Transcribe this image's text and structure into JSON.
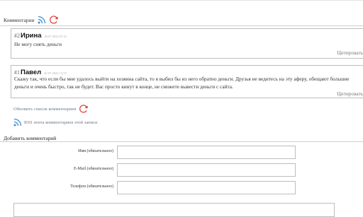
{
  "header": {
    "title": "Комментарии"
  },
  "comments": [
    {
      "num": "#2",
      "author": "Ирина",
      "date": "26.07.2022 07:31",
      "text": "Не могу снять деньги",
      "quote": "Цитировать"
    },
    {
      "num": "#1",
      "author": "Павел",
      "date": "26.07.2022 13:37",
      "text": "Скажу так, что если бы мне удалось выйти на хозяина сайта, то я выбил бы из него обратно деньги. Друзья не ведитесь на эту аферу, обещают большие деньги и очень быстро, так не будет. Вас просто кинут в конце, не сможете вывести деньги с сайта.",
      "quote": "Цитировать"
    }
  ],
  "refresh": {
    "label": "Обновить список комментариев"
  },
  "rss": {
    "label": "RSS лента комментариев этой записи"
  },
  "form": {
    "title": "Добавить комментарий",
    "name_label": "Имя (обязательное)",
    "email_label": "E-Mail (обязательное)",
    "phone_label": "Телефон (обязательное)"
  },
  "colors": {
    "rss": "#3f8fd1",
    "refresh": "#e0433a",
    "border": "#bdbdbd"
  },
  "icons": [
    "rss-icon",
    "refresh-icon"
  ]
}
